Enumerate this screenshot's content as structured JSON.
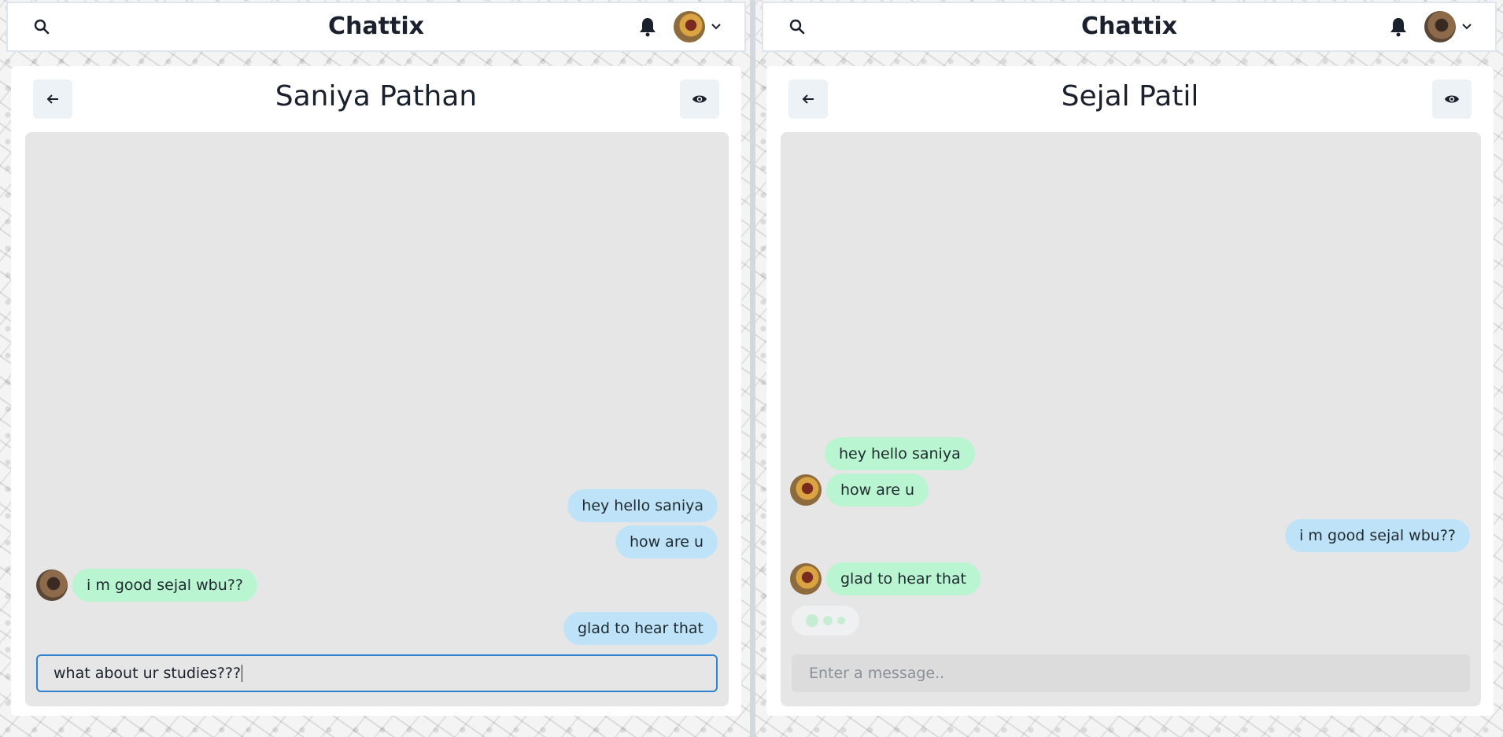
{
  "panes": {
    "left": {
      "brand": "Chattix",
      "chat_title": "Saniya Pathan",
      "messages": [
        {
          "text": "hey hello saniya",
          "side": "sent"
        },
        {
          "text": "how are u",
          "side": "sent"
        },
        {
          "text": "i m good sejal wbu??",
          "side": "received"
        },
        {
          "text": "glad to hear that",
          "side": "sent"
        }
      ],
      "input": {
        "value": "what about ur studies???",
        "placeholder": "Enter a message.."
      }
    },
    "right": {
      "brand": "Chattix",
      "chat_title": "Sejal Patil",
      "messages": [
        {
          "text": "hey hello saniya",
          "side": "received"
        },
        {
          "text": "how are u",
          "side": "received"
        },
        {
          "text": "i m good sejal wbu??",
          "side": "sent"
        },
        {
          "text": "glad to hear that",
          "side": "received"
        }
      ],
      "input": {
        "value": "",
        "placeholder": "Enter a message.."
      },
      "typing_indicator": true
    }
  },
  "icons": {
    "search": "search-icon",
    "bell": "bell-icon",
    "chevron": "chevron-down-icon",
    "back": "arrow-left-icon",
    "eye": "eye-icon"
  },
  "colors": {
    "sent_bubble": "#bee3f8",
    "received_bubble": "#b9f5d0",
    "chat_background": "#e6e6e6",
    "input_focus_border": "#3182ce"
  }
}
